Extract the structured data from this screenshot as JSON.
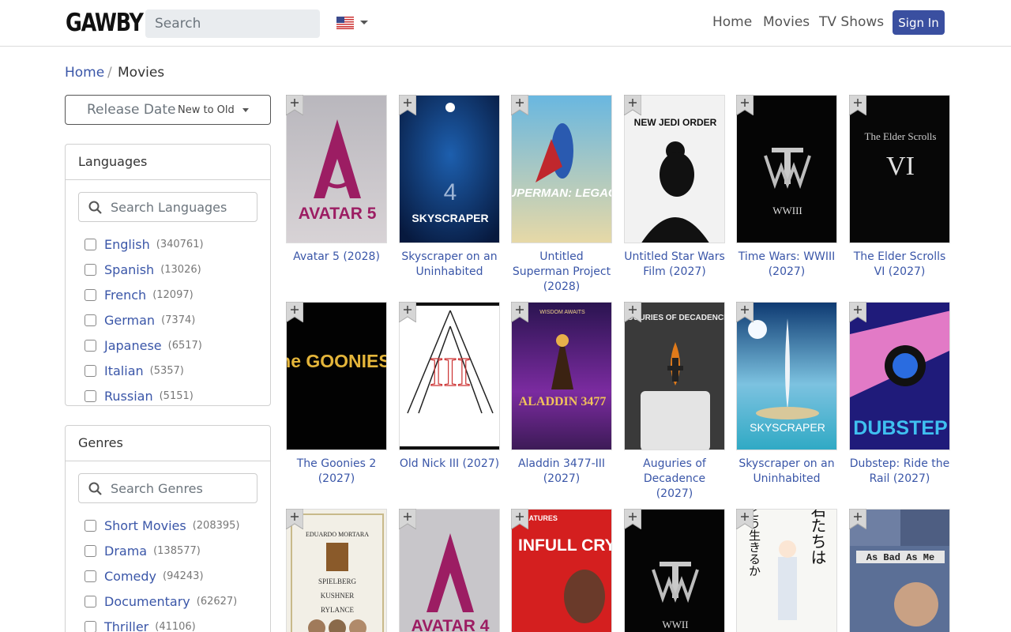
{
  "header": {
    "logo": "GAWBY",
    "search_placeholder": "Search",
    "flag_icon": "us-flag-icon",
    "nav": [
      "Home",
      "Movies",
      "TV Shows"
    ],
    "signin": "Sign In",
    "accent": "#3a4fa0"
  },
  "breadcrumb": {
    "home": "Home",
    "separator": "/",
    "current": "Movies"
  },
  "sort": {
    "label": "Release Date",
    "value": "New to Old"
  },
  "languages": {
    "title": "Languages",
    "search_placeholder": "Search Languages",
    "items": [
      {
        "name": "English",
        "count": "(340761)"
      },
      {
        "name": "Spanish",
        "count": "(13026)"
      },
      {
        "name": "French",
        "count": "(12097)"
      },
      {
        "name": "German",
        "count": "(7374)"
      },
      {
        "name": "Japanese",
        "count": "(6517)"
      },
      {
        "name": "Italian",
        "count": "(5357)"
      },
      {
        "name": "Russian",
        "count": "(5151)"
      }
    ]
  },
  "genres": {
    "title": "Genres",
    "search_placeholder": "Search Genres",
    "items": [
      {
        "name": "Short Movies",
        "count": "(208395)"
      },
      {
        "name": "Drama",
        "count": "(138577)"
      },
      {
        "name": "Comedy",
        "count": "(94243)"
      },
      {
        "name": "Documentary",
        "count": "(62627)"
      },
      {
        "name": "Thriller",
        "count": "(41106)"
      }
    ]
  },
  "movies": [
    {
      "title": "Avatar 5 (2028)",
      "poster_text": "AVATAR 5"
    },
    {
      "title": "Skyscraper on an Uninhabited",
      "poster_text": "SKYSCRAPER"
    },
    {
      "title": "Untitled Superman Project (2028)",
      "poster_text": "SUPERMAN: LEGACY"
    },
    {
      "title": "Untitled Star Wars Film (2027)",
      "poster_text": "NEW JEDI ORDER"
    },
    {
      "title": "Time Wars: WWIII (2027)",
      "poster_text": "WWIII"
    },
    {
      "title": "The Elder Scrolls VI (2027)",
      "poster_text": "The Elder Scrolls VI"
    },
    {
      "title": "The Goonies 2 (2027)",
      "poster_text": "The GOONIES II"
    },
    {
      "title": "Old Nick III (2027)",
      "poster_text": "III"
    },
    {
      "title": "Aladdin 3477-III (2027)",
      "poster_text": "ALADDIN 3477"
    },
    {
      "title": "Auguries of Decadence (2027)",
      "poster_text": "AUGURIES OF DECADENCE"
    },
    {
      "title": "Skyscraper on an Uninhabited",
      "poster_text": "SKYSCRAPER"
    },
    {
      "title": "Dubstep: Ride the Rail (2027)",
      "poster_text": "DUBSTEP"
    },
    {
      "title": "",
      "poster_text": "EDUARDO MORTARA"
    },
    {
      "title": "",
      "poster_text": "AVATAR 4"
    },
    {
      "title": "",
      "poster_text": "INFULL CRY"
    },
    {
      "title": "",
      "poster_text": "WWII"
    },
    {
      "title": "",
      "poster_text": "君たちはどう生きるか"
    },
    {
      "title": "",
      "poster_text": "As Bad As Me"
    }
  ]
}
